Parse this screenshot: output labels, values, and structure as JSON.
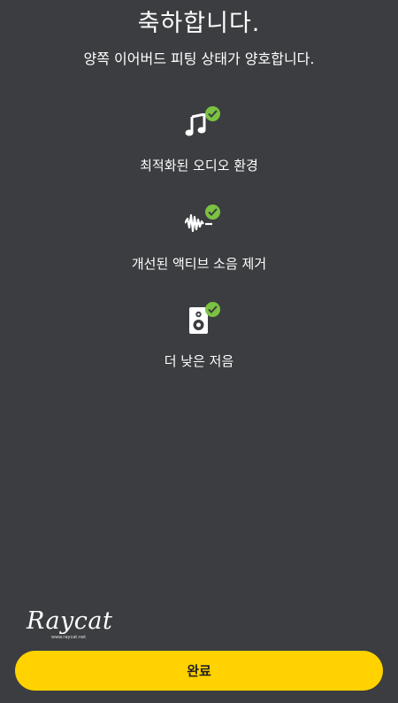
{
  "header": {
    "title": "축하합니다.",
    "subtitle": "양쪽 이어버드 피팅 상태가 양호합니다."
  },
  "features": [
    {
      "icon": "music-note-icon",
      "label": "최적화된 오디오 환경",
      "status": "check-icon"
    },
    {
      "icon": "soundwave-icon",
      "label": "개선된 액티브 소음 제거",
      "status": "check-icon"
    },
    {
      "icon": "speaker-icon",
      "label": "더 낮은 저음",
      "status": "check-icon"
    }
  ],
  "watermark": {
    "logo_text": "Raycat",
    "url": "www.raycat.net"
  },
  "footer": {
    "done_label": "완료"
  },
  "colors": {
    "background": "#3b3d40",
    "accent": "#ffd200",
    "check": "#7cc242"
  }
}
